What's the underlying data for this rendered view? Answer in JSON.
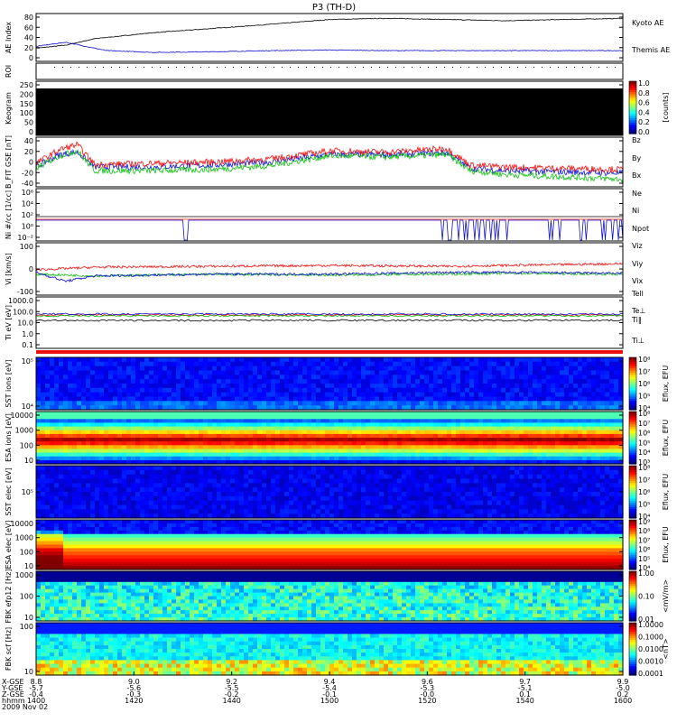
{
  "chart_data": {
    "type": "line",
    "title": "P3 (TH-D)",
    "colors": {
      "black": "#000000",
      "blue": "#1010d0",
      "red": "#ee1010",
      "green": "#10c010"
    },
    "x_axis": {
      "labels": [
        "X-GSE",
        "Y-GSE",
        "Z-GSE",
        "hhmm",
        "2009 Nov 02"
      ],
      "ticks": [
        {
          "x": "8.8",
          "y": "-5.7",
          "z": "-0.4",
          "t": "1400"
        },
        {
          "x": "9.0",
          "y": "-5.6",
          "z": "-0.3",
          "t": "1420"
        },
        {
          "x": "9.2",
          "y": "-5.5",
          "z": "-0.2",
          "t": "1440"
        },
        {
          "x": "9.4",
          "y": "-5.4",
          "z": "-0.1",
          "t": "1500"
        },
        {
          "x": "9.6",
          "y": "-5.3",
          "z": "-0.0",
          "t": "1520"
        },
        {
          "x": "9.7",
          "y": "-5.1",
          "z": "0.1",
          "t": "1540"
        },
        {
          "x": "9.9",
          "y": "-5.0",
          "z": "0.2",
          "t": "1600"
        }
      ]
    },
    "panels": [
      {
        "id": "ae",
        "ylabel": "AE Index",
        "yticks": [
          "80",
          "60",
          "40",
          "20",
          "0"
        ],
        "ylim": [
          0,
          80
        ],
        "series": [
          {
            "name": "Kyoto AE",
            "color": "#000000",
            "x": [
              0,
              0.05,
              0.1,
              0.2,
              0.3,
              0.4,
              0.5,
              0.6,
              0.7,
              0.8,
              0.9,
              1.0
            ],
            "y": [
              22,
              27,
              38,
              48,
              55,
              62,
              70,
              72,
              70,
              68,
              70,
              72
            ]
          },
          {
            "name": "Themis AE",
            "color": "#1010d0",
            "x": [
              0,
              0.05,
              0.08,
              0.12,
              0.2,
              0.3,
              0.4,
              0.5,
              0.6,
              0.7,
              0.8,
              0.9,
              1.0
            ],
            "y": [
              25,
              32,
              26,
              18,
              15,
              16,
              18,
              19,
              18,
              18,
              18,
              18,
              18
            ]
          }
        ]
      },
      {
        "id": "roi",
        "ylabel": "ROI"
      },
      {
        "id": "keogram",
        "ylabel": "Keogram",
        "yticks": [
          "250",
          "200",
          "150",
          "100",
          "50",
          "0"
        ],
        "colorbar": {
          "ticks": [
            "1.0",
            "0.8",
            "0.6",
            "0.4",
            "0.2",
            "0.0"
          ],
          "label": "[counts]"
        }
      },
      {
        "id": "bfit",
        "ylabel": "B_FIT GSE [nT]",
        "yticks": [
          "40",
          "20",
          "0",
          "-20",
          "-40"
        ],
        "ylim": [
          -40,
          40
        ],
        "series": [
          {
            "name": "Bz",
            "color": "#ee1010",
            "x": [
              0,
              0.04,
              0.07,
              0.1,
              0.2,
              0.3,
              0.4,
              0.5,
              0.6,
              0.7,
              0.74,
              0.8,
              0.9,
              1.0
            ],
            "y": [
              -2,
              20,
              28,
              -4,
              -2,
              0,
              5,
              18,
              16,
              22,
              -5,
              -8,
              -10,
              -12
            ]
          },
          {
            "name": "By",
            "color": "#10c010",
            "x": [
              0,
              0.04,
              0.07,
              0.1,
              0.2,
              0.3,
              0.4,
              0.5,
              0.6,
              0.7,
              0.74,
              0.8,
              0.9,
              1.0
            ],
            "y": [
              -10,
              10,
              18,
              -14,
              -14,
              -12,
              -6,
              10,
              8,
              12,
              -14,
              -20,
              -24,
              -28
            ]
          },
          {
            "name": "Bx",
            "color": "#1010d0",
            "x": [
              0,
              0.04,
              0.07,
              0.1,
              0.2,
              0.3,
              0.4,
              0.5,
              0.6,
              0.7,
              0.74,
              0.8,
              0.9,
              1.0
            ],
            "y": [
              -8,
              12,
              16,
              -8,
              -8,
              -5,
              0,
              12,
              12,
              15,
              -10,
              -14,
              -16,
              -18
            ]
          }
        ]
      },
      {
        "id": "n",
        "ylabel": "Ni #/cc [1/cc]",
        "yticks": [
          "10⁶",
          "10⁴",
          "10²",
          "10⁰",
          "10⁻²"
        ],
        "series": [
          {
            "name": "Ne",
            "color": "#ee1010"
          },
          {
            "name": "Ni",
            "color": "#000000"
          },
          {
            "name": "Npot",
            "color": "#1010d0"
          }
        ]
      },
      {
        "id": "v",
        "ylabel": "Vi [km/s]",
        "yticks": [
          "100",
          "0",
          "-100"
        ],
        "ylim": [
          -150,
          150
        ],
        "series": [
          {
            "name": "Viz",
            "color": "#ee1010",
            "x": [
              0,
              0.1,
              0.3,
              0.5,
              0.7,
              0.8,
              1.0
            ],
            "y": [
              -5,
              10,
              15,
              20,
              15,
              20,
              30
            ]
          },
          {
            "name": "Viy",
            "color": "#10c010",
            "x": [
              0,
              0.1,
              0.3,
              0.5,
              0.7,
              0.8,
              1.0
            ],
            "y": [
              -30,
              -40,
              -30,
              -35,
              -30,
              -25,
              -30
            ]
          },
          {
            "name": "Vix",
            "color": "#1010d0",
            "x": [
              0,
              0.05,
              0.1,
              0.3,
              0.5,
              0.7,
              0.8,
              1.0
            ],
            "y": [
              -20,
              -70,
              -40,
              -30,
              -30,
              -20,
              -20,
              -25
            ]
          }
        ]
      },
      {
        "id": "temp",
        "ylabel": "Ti eV [eV]",
        "yticks": [
          "1000.0",
          "100.0",
          "10.0",
          "1.0",
          "0.1"
        ],
        "series": [
          {
            "name": "Tell",
            "color": "#000000"
          },
          {
            "name": "Te⊥",
            "color": "#ee1010"
          },
          {
            "name": "Ti‖",
            "color": "#10c010"
          },
          {
            "name": "Ti⊥",
            "color": "#1010d0"
          }
        ]
      },
      {
        "id": "sst_i",
        "ylabel": "SST ions [eV]",
        "yticks": [
          "10⁵",
          "10⁴"
        ],
        "colorbar": {
          "label": "Eflux, EFU",
          "ticks": [
            "10⁸",
            "10⁷",
            "10⁶",
            "10⁵",
            "10⁴"
          ]
        }
      },
      {
        "id": "esa_i",
        "ylabel": "ESA ions [eV]",
        "yticks": [
          "10000",
          "1000",
          "100",
          "10"
        ],
        "colorbar": {
          "label": "Eflux, EFU",
          "ticks": [
            "10⁸",
            "10⁷",
            "10⁶",
            "10⁵",
            "10⁴",
            "10³"
          ]
        }
      },
      {
        "id": "sst_e",
        "ylabel": "SST elec [eV]",
        "yticks": [
          "10⁵"
        ],
        "colorbar": {
          "label": "Eflux, EFU",
          "ticks": [
            "10⁸",
            "10⁷",
            "10⁶",
            "10⁵",
            "10⁴"
          ]
        }
      },
      {
        "id": "esa_e",
        "ylabel": "ESA elec [eV]",
        "yticks": [
          "10000",
          "1000",
          "100",
          "10"
        ],
        "colorbar": {
          "label": "Eflux, EFU",
          "ticks": [
            "10⁹",
            "10⁸",
            "10⁷",
            "10⁶",
            "10⁵",
            "10⁴"
          ]
        }
      },
      {
        "id": "fbk_e",
        "ylabel": "FBK efp12 [Hz]",
        "yticks": [
          "1000",
          "100",
          "10"
        ],
        "colorbar": {
          "label": "<mV/m>",
          "ticks": [
            "1.00",
            "0.10",
            "0.01"
          ]
        }
      },
      {
        "id": "fbk_b",
        "ylabel": "FBK scf [Hz]",
        "yticks": [
          "100",
          "10"
        ],
        "colorbar": {
          "label": "<nT>",
          "ticks": [
            "1.0000",
            "0.1000",
            "0.0100",
            "0.0010",
            "0.0001"
          ]
        }
      }
    ]
  }
}
